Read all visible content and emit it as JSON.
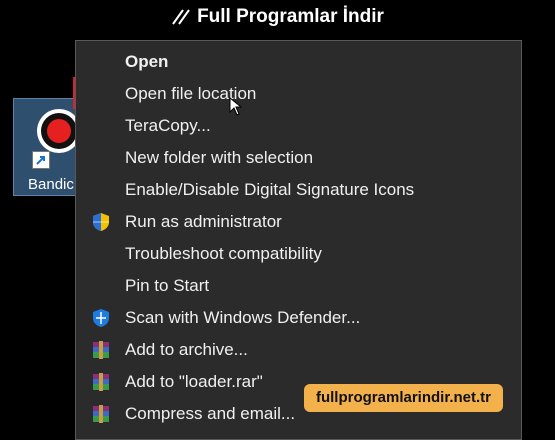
{
  "banner": {
    "title": "Full Programlar İndir"
  },
  "desktop_icon": {
    "label": "Bandic"
  },
  "menu": {
    "items": [
      {
        "label": "Open"
      },
      {
        "label": "Open file location"
      },
      {
        "label": "TeraCopy..."
      },
      {
        "label": "New folder with selection"
      },
      {
        "label": "Enable/Disable Digital Signature Icons"
      },
      {
        "label": "Run as administrator",
        "icon": "uac-shield-icon"
      },
      {
        "label": "Troubleshoot compatibility"
      },
      {
        "label": "Pin to Start"
      },
      {
        "label": "Scan with Windows Defender...",
        "icon": "defender-shield-icon"
      },
      {
        "label": "Add to archive...",
        "icon": "winrar-icon"
      },
      {
        "label": "Add to \"loader.rar\"",
        "icon": "winrar-icon"
      },
      {
        "label": "Compress and email...",
        "icon": "winrar-icon"
      }
    ]
  },
  "watermark": {
    "url": "fullprogramlarindir.net.tr"
  },
  "colors": {
    "highlight_border": "#e01f2d",
    "badge": "#f3b14c",
    "menu_bg": "#2b2b2b"
  }
}
